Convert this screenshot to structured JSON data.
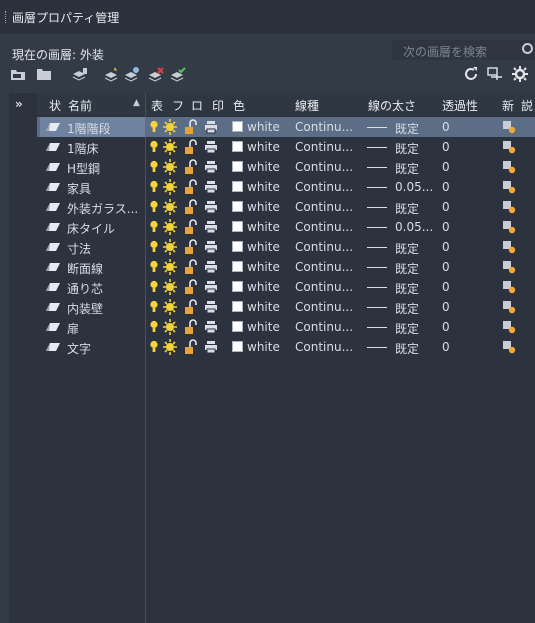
{
  "panel": {
    "title": "画層プロパティ管理",
    "current_layer": "現在の画層: 外装",
    "search_placeholder": "次の画層を検索"
  },
  "columns": [
    "状",
    "名前",
    "表",
    "フ",
    "ロ",
    "印",
    "色",
    "線種",
    "線の太さ",
    "透過性",
    "新",
    "説"
  ],
  "collapse_label": "»",
  "layers": [
    {
      "name": "1階階段",
      "color": "white",
      "linetype": "Continu...",
      "lineweight": "既定",
      "transparency": "0",
      "selected": true
    },
    {
      "name": "1階床",
      "color": "white",
      "linetype": "Continu...",
      "lineweight": "既定",
      "transparency": "0"
    },
    {
      "name": "H型鋼",
      "color": "white",
      "linetype": "Continu...",
      "lineweight": "既定",
      "transparency": "0"
    },
    {
      "name": "家具",
      "color": "white",
      "linetype": "Continu...",
      "lineweight": "0.05...",
      "transparency": "0"
    },
    {
      "name": "外装ガラス...",
      "color": "white",
      "linetype": "Continu...",
      "lineweight": "既定",
      "transparency": "0"
    },
    {
      "name": "床タイル",
      "color": "white",
      "linetype": "Continu...",
      "lineweight": "0.05...",
      "transparency": "0"
    },
    {
      "name": "寸法",
      "color": "white",
      "linetype": "Continu...",
      "lineweight": "既定",
      "transparency": "0"
    },
    {
      "name": "断面線",
      "color": "white",
      "linetype": "Continu...",
      "lineweight": "既定",
      "transparency": "0"
    },
    {
      "name": "通り芯",
      "color": "white",
      "linetype": "Continu...",
      "lineweight": "既定",
      "transparency": "0"
    },
    {
      "name": "内装壁",
      "color": "white",
      "linetype": "Continu...",
      "lineweight": "既定",
      "transparency": "0"
    },
    {
      "name": "扉",
      "color": "white",
      "linetype": "Continu...",
      "lineweight": "既定",
      "transparency": "0"
    },
    {
      "name": "文字",
      "color": "white",
      "linetype": "Continu...",
      "lineweight": "既定",
      "transparency": "0"
    }
  ],
  "icons": {
    "toolbar": [
      "new-property-filter-icon",
      "new-group-filter-icon",
      "layer-states-manager-icon",
      "new-layer-icon",
      "new-layer-vp-frozen-icon",
      "delete-layer-icon",
      "set-current-icon",
      "refresh-icon",
      "settings-icon",
      "gear-icon"
    ],
    "row": [
      "layer-pen-icon",
      "lightbulb-on-icon",
      "sun-thawed-icon",
      "lock-unlocked-icon",
      "printer-icon",
      "new-vp-freeze-icon"
    ]
  },
  "colors": {
    "background": "#333b47",
    "grid_background": "#2c333e",
    "selected_row": "#5c6d86",
    "selected_name": "#6f829f",
    "bulb_yellow": "#f4d23a",
    "lock_orange": "#e8a23c"
  }
}
